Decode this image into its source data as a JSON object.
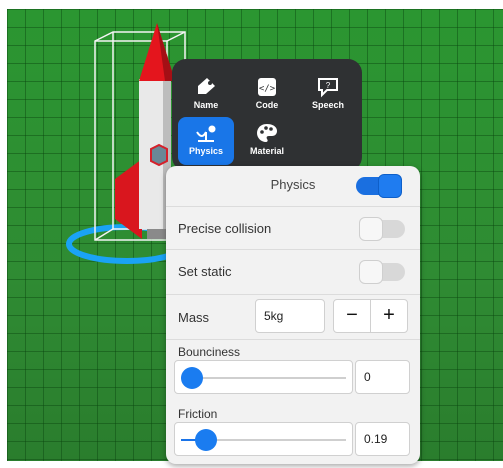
{
  "object_menu": {
    "items": [
      {
        "label": "Name",
        "icon": "tag-icon"
      },
      {
        "label": "Code",
        "icon": "code-icon"
      },
      {
        "label": "Speech",
        "icon": "speech-bubble-icon"
      },
      {
        "label": "Physics",
        "icon": "physics-icon",
        "selected": true
      },
      {
        "label": "Material",
        "icon": "palette-icon"
      }
    ]
  },
  "physics_panel": {
    "title": "Physics",
    "physics_enabled": true,
    "precise_collision": {
      "label": "Precise collision",
      "enabled": false
    },
    "set_static": {
      "label": "Set static",
      "enabled": false
    },
    "mass": {
      "label": "Mass",
      "value": "5kg",
      "minus": "−",
      "plus": "+"
    },
    "bounciness": {
      "label": "Bounciness",
      "value": "0",
      "fraction": 0.0
    },
    "friction": {
      "label": "Friction",
      "value": "0.19",
      "fraction": 0.19
    }
  },
  "colors": {
    "accent": "#1a73e8",
    "ground": "#2e8f33",
    "menu_bg": "#2f3133",
    "rocket_red": "#e11d23"
  }
}
